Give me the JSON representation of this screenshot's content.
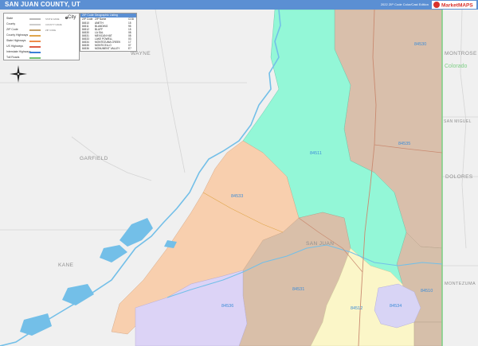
{
  "header": {
    "title": "SAN JUAN COUNTY, UT",
    "edition": "2022 ZIP Code Color/Cast Edition",
    "logo_text": "MarketMAPS"
  },
  "counties": {
    "wayne": "WAYNE",
    "garfield": "GARFIELD",
    "kane": "KANE",
    "san_juan": "SAN JUAN",
    "montrose": "MONTROSE",
    "san_miguel": "SAN MIGUEL",
    "dolores": "DOLORES",
    "montezuma": "MONTEZUMA"
  },
  "states": {
    "colorado": "Colorado"
  },
  "zip_labels": {
    "z84530": "84530",
    "z84511": "84511",
    "z84535": "84535",
    "z84533": "84533",
    "z84531": "84531",
    "z84536": "84536",
    "z84512": "84512",
    "z84534": "84534",
    "z84510": "84510"
  },
  "legend": {
    "city_label": "City",
    "rows": [
      {
        "label": "State",
        "sample": "STATE NAME"
      },
      {
        "label": "County",
        "sample": "COUNTY NAME"
      },
      {
        "label": "ZIP Code",
        "sample": "ZIP CODE"
      },
      {
        "label": "County Highways",
        "sample": ""
      },
      {
        "label": "State Highways",
        "sample": ""
      },
      {
        "label": "US Highways",
        "sample": ""
      },
      {
        "label": "Interstate Highways",
        "sample": ""
      },
      {
        "label": "Toll Roads",
        "sample": ""
      }
    ],
    "colors": [
      "#bbbbbb",
      "#cccccc",
      "#c3a16a",
      "#e0a64b",
      "#ee8b4a",
      "#de5c43",
      "#3a7fd6",
      "#6fbf6f"
    ]
  },
  "zip_legend": {
    "title": "ZIP Code Geographic Listing",
    "headers": [
      "ZIP Code",
      "ZIP Name",
      "COD"
    ],
    "rows": [
      [
        "84510",
        "ANETH",
        "15"
      ],
      [
        "84511",
        "BLANDING",
        "95"
      ],
      [
        "84512",
        "BLUFF",
        "15"
      ],
      [
        "84530",
        "LA SAL",
        "08"
      ],
      [
        "84531",
        "MEXICAN HAT",
        "08"
      ],
      [
        "84533",
        "LAKE POWELL",
        "03"
      ],
      [
        "84534",
        "MONTEZUMA CREEK",
        "17"
      ],
      [
        "84535",
        "MONTICELLO",
        "07"
      ],
      [
        "84536",
        "MONUMENT VALLEY",
        "E7"
      ]
    ]
  },
  "zone_colors": {
    "z84530": "#d9bfab",
    "z84511": "#93f7d7",
    "z84535": "#d6b8a7",
    "z84533": "#f8cfae",
    "z84531": "#d9bfa9",
    "z84536": "#dcd3f6",
    "z84512": "#fbf6c8",
    "z84534": "#d8d4f5",
    "z84510": "#d6bfaa",
    "outside": "#f0f0f0",
    "water": "#73bfe8",
    "header": "#5b8fd3"
  }
}
